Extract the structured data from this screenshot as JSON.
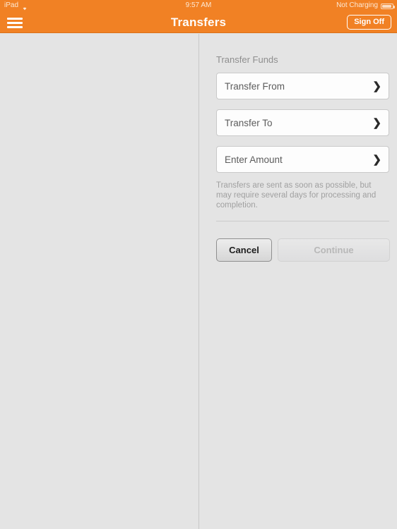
{
  "statusbar": {
    "device_label": "iPad",
    "wifi_icon": "wifi-icon",
    "time": "9:57 AM",
    "battery_status": "Not Charging",
    "battery_icon": "battery-icon"
  },
  "navbar": {
    "menu_icon": "hamburger-menu-icon",
    "title": "Transfers",
    "sign_off_label": "Sign Off",
    "background_color": "#f18124"
  },
  "main": {
    "section_title": "Transfer Funds",
    "rows": [
      {
        "label": "Transfer From",
        "value": "",
        "chevron": "chevron-right-icon"
      },
      {
        "label": "Transfer To",
        "value": "",
        "chevron": "chevron-right-icon"
      },
      {
        "label": "Enter Amount",
        "value": "",
        "chevron": "chevron-right-icon"
      }
    ],
    "note": "Transfers are sent as soon as possible, but may require several days for processing and completion.",
    "buttons": {
      "cancel_label": "Cancel",
      "continue_label": "Continue",
      "continue_enabled": false
    }
  },
  "colors": {
    "accent": "#f18124",
    "page_background": "#e4e4e4",
    "field_background": "#fdfdfd",
    "muted_text": "#a0a0a0"
  }
}
